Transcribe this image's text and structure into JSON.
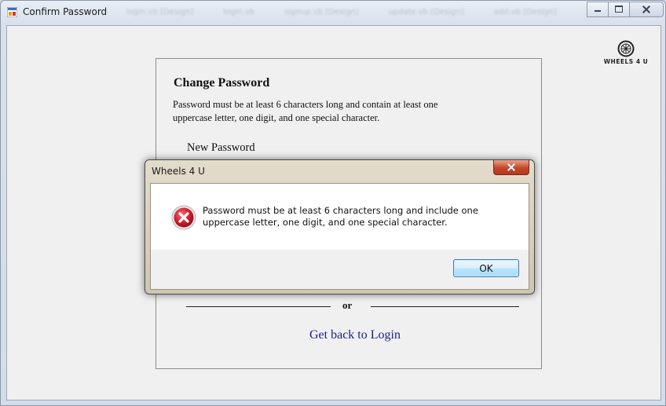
{
  "window": {
    "title": "Confirm Password",
    "background_tabs": [
      "login.vb [Design]",
      "login.vb",
      "signup.vb [Design]",
      "update.vb [Design]",
      "add.vb [Design]"
    ]
  },
  "brand": {
    "label": "WHEELS 4 U",
    "icon": "wheel-icon"
  },
  "form": {
    "heading": "Change Password",
    "description": "Password must be at least 6 characters long and contain at least one uppercase letter, one digit, and one special character.",
    "new_password_label": "New Password",
    "separator_text": "or",
    "login_link": "Get back to Login"
  },
  "dialog": {
    "title": "Wheels 4 U",
    "message": "Password must be at least 6 characters long and include one uppercase letter, one digit, and one special character.",
    "icon": "error-icon",
    "ok_label": "OK"
  },
  "colors": {
    "link": "#1a1f8f",
    "error_icon": "#c8192b",
    "dialog_frame": "#d8d0bc",
    "close_button": "#c7452a"
  }
}
